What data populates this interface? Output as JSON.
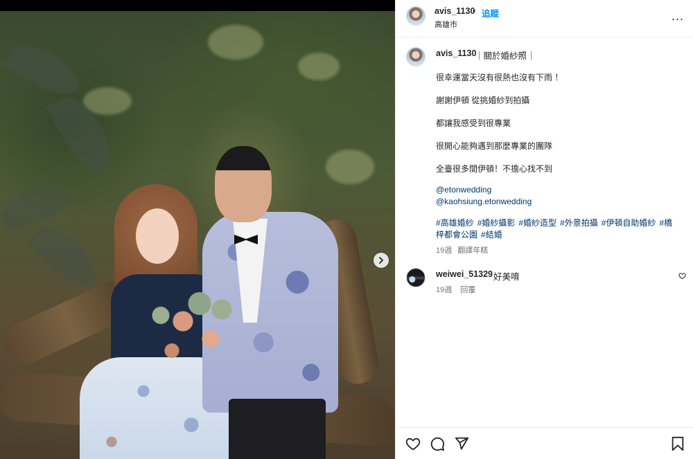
{
  "post": {
    "username": "avis_1130",
    "separator": "•",
    "follow_label": "追蹤",
    "location": "高雄市",
    "more_label": "..."
  },
  "caption": {
    "username": "avis_1130",
    "title": "｜關於婚紗照｜",
    "lines": [
      "很幸運當天沒有很熱也沒有下雨 ！",
      "謝謝伊頓 從挑婚紗到拍攝",
      "都讓我感受到很專業",
      "很開心能夠遇到那麼專業的團隊",
      "全臺很多間伊頓！不擔心找不到"
    ],
    "mentions": [
      "@etonwedding",
      "@kaohsiung.etonwedding"
    ],
    "hashtags": [
      "#高雄婚紗",
      "#婚紗攝影",
      "#婚紗造型",
      "#外景拍攝",
      "#伊頓自助婚紗",
      "#橋梓都會公園",
      "#結婚"
    ],
    "age": "19週",
    "translate_label": "翻譯年糕"
  },
  "comment": {
    "username": "weiwei_51329",
    "text": "好美唷",
    "age": "19週",
    "reply_label": "回覆"
  },
  "icons": {
    "next": "chevron-right-icon",
    "like": "heart-icon",
    "comment": "comment-icon",
    "share": "send-icon",
    "save": "bookmark-icon"
  },
  "colors": {
    "link_blue": "#0095f6",
    "mention_blue": "#00376b",
    "meta_gray": "#737373",
    "divider": "#efefef"
  }
}
